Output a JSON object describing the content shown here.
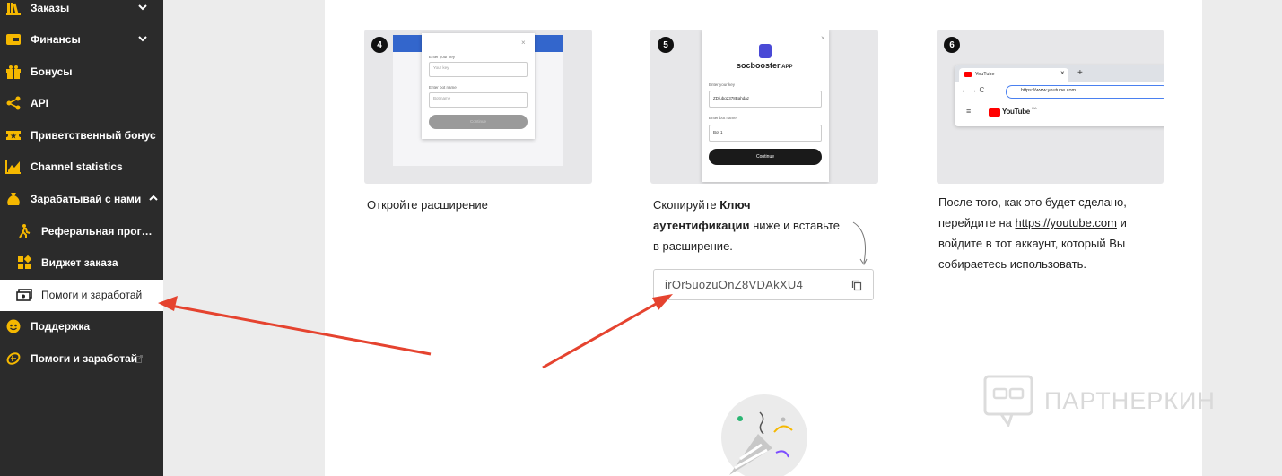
{
  "sidebar": {
    "items": [
      {
        "label": "Заказы",
        "icon": "books-icon"
      },
      {
        "label": "Финансы",
        "icon": "wallet-icon"
      },
      {
        "label": "Бонусы",
        "icon": "gift-icon"
      },
      {
        "label": "API",
        "icon": "share-icon"
      },
      {
        "label": "Приветственный бонус",
        "icon": "ticket-icon"
      },
      {
        "label": "Channel statistics",
        "icon": "chart-icon"
      },
      {
        "label": "Зарабатывай с нами",
        "icon": "money-bag-icon"
      },
      {
        "label": "Реферальная програ...",
        "icon": "walking-person-icon"
      },
      {
        "label": "Виджет заказа",
        "icon": "widget-icon"
      },
      {
        "label": "Помоги и заработай",
        "icon": "cash-icon"
      },
      {
        "label": "Поддержка",
        "icon": "support-face-icon"
      },
      {
        "label": "Помоги и заработай",
        "icon": "coin-icon"
      }
    ]
  },
  "steps": [
    {
      "number": "4",
      "text": "Откройте расширение",
      "mock": {
        "key_label": "Enter your key",
        "key_placeholder": "Your key",
        "bot_label": "Enter bot name",
        "bot_placeholder": "Bot name",
        "button": "Continue"
      }
    },
    {
      "number": "5",
      "text_before": "Скопируйте ",
      "text_bold": "Ключ аутентификации",
      "text_after": " ниже и вставьте в расширение.",
      "mock": {
        "brand": "socbooster",
        "brand_suffix": ".APP",
        "key_label": "Enter your key",
        "key_value": "ZDfubq2378Bahdaz",
        "bot_label": "Enter bot name",
        "bot_value": "Bot 1",
        "button": "Continue"
      }
    },
    {
      "number": "6",
      "text_before": "После того, как это будет сделано, перейдите на ",
      "link": "https://youtube.com",
      "text_after": " и войдите в тот аккаунт, который Вы собираетесь использовать.",
      "mock": {
        "tab_title": "YouTube",
        "url": "https://www.youtube.com",
        "logo": "YouTube",
        "logo_sup": "UA"
      }
    }
  ],
  "auth_key": "irOr5uozuOnZ8VDAkXU4",
  "watermark": "ПАРТНЕРКИН",
  "colors": {
    "accent": "#f5b800",
    "sidebar_bg": "#2b2b2b",
    "arrow": "#e5432f",
    "link": "#1a73e8",
    "blue_bar": "#3366cc"
  }
}
